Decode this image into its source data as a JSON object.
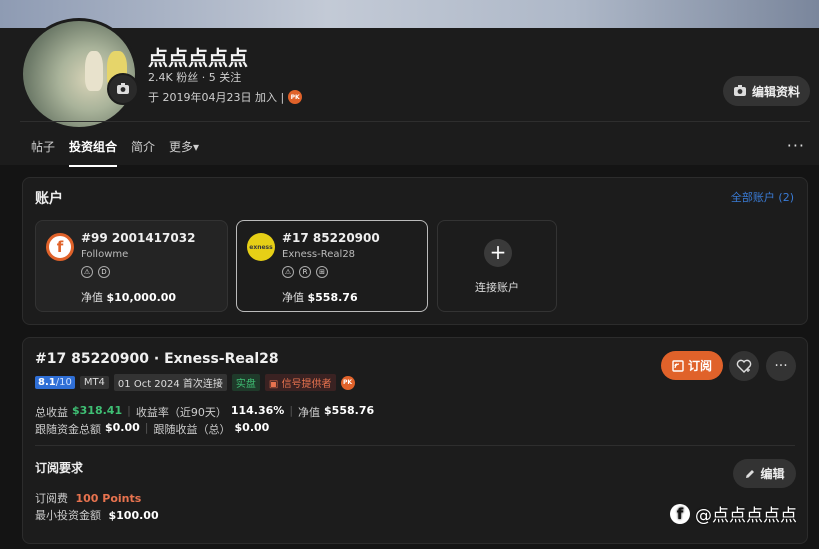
{
  "profile": {
    "name": "点点点点点",
    "stats": "2.4K 粉丝 · 5 关注",
    "joined": "于 2019年04月23日 加入 |",
    "pk_badge": "PK",
    "edit_label": "编辑资料"
  },
  "tabs": [
    {
      "label": "帖子"
    },
    {
      "label": "投资组合",
      "active": true
    },
    {
      "label": "简介"
    },
    {
      "label": "更多▾"
    }
  ],
  "more_icon": "···",
  "accounts": {
    "title": "账户",
    "all_link": "全部账户 (2)",
    "items": [
      {
        "number": "#99 2001417032",
        "broker": "Followme",
        "logo": "f",
        "icons": [
          "⚠",
          "D"
        ],
        "net_label": "净值",
        "net_value": "$10,000.00"
      },
      {
        "number": "#17 85220900",
        "broker": "Exness-Real28",
        "logo": "exness",
        "icons": [
          "⚠",
          "R",
          "⊞"
        ],
        "net_label": "净值",
        "net_value": "$558.76"
      }
    ],
    "connect_label": "连接账户"
  },
  "detail": {
    "title": "#17 85220900 · Exness-Real28",
    "score": "8.1",
    "score_max": "/10",
    "platform": "MT4",
    "first_connect": "01 Oct 2024 首次连接",
    "live_badge": "实盘",
    "provider_badge": "信号提供者",
    "subscribe_label": "订阅",
    "total_profit_label": "总收益",
    "total_profit": "$318.41",
    "return_label": "收益率（近90天）",
    "return_value": "114.36%",
    "net_label": "净值",
    "net_value": "$558.76",
    "follow_total_label": "跟随资金总额",
    "follow_total": "$0.00",
    "follow_profit_label": "跟随收益（总）",
    "follow_profit": "$0.00",
    "req_title": "订阅要求",
    "edit_label": "编辑",
    "fee_label": "订阅费",
    "fee_value": "100 Points",
    "min_label": "最小投资金额",
    "min_value": "$100.00"
  },
  "watermark": "@点点点点点",
  "colors": {
    "accent": "#e0622a",
    "link": "#3a7bd5",
    "green": "#3fbf74",
    "score": "#2f6fd6"
  }
}
